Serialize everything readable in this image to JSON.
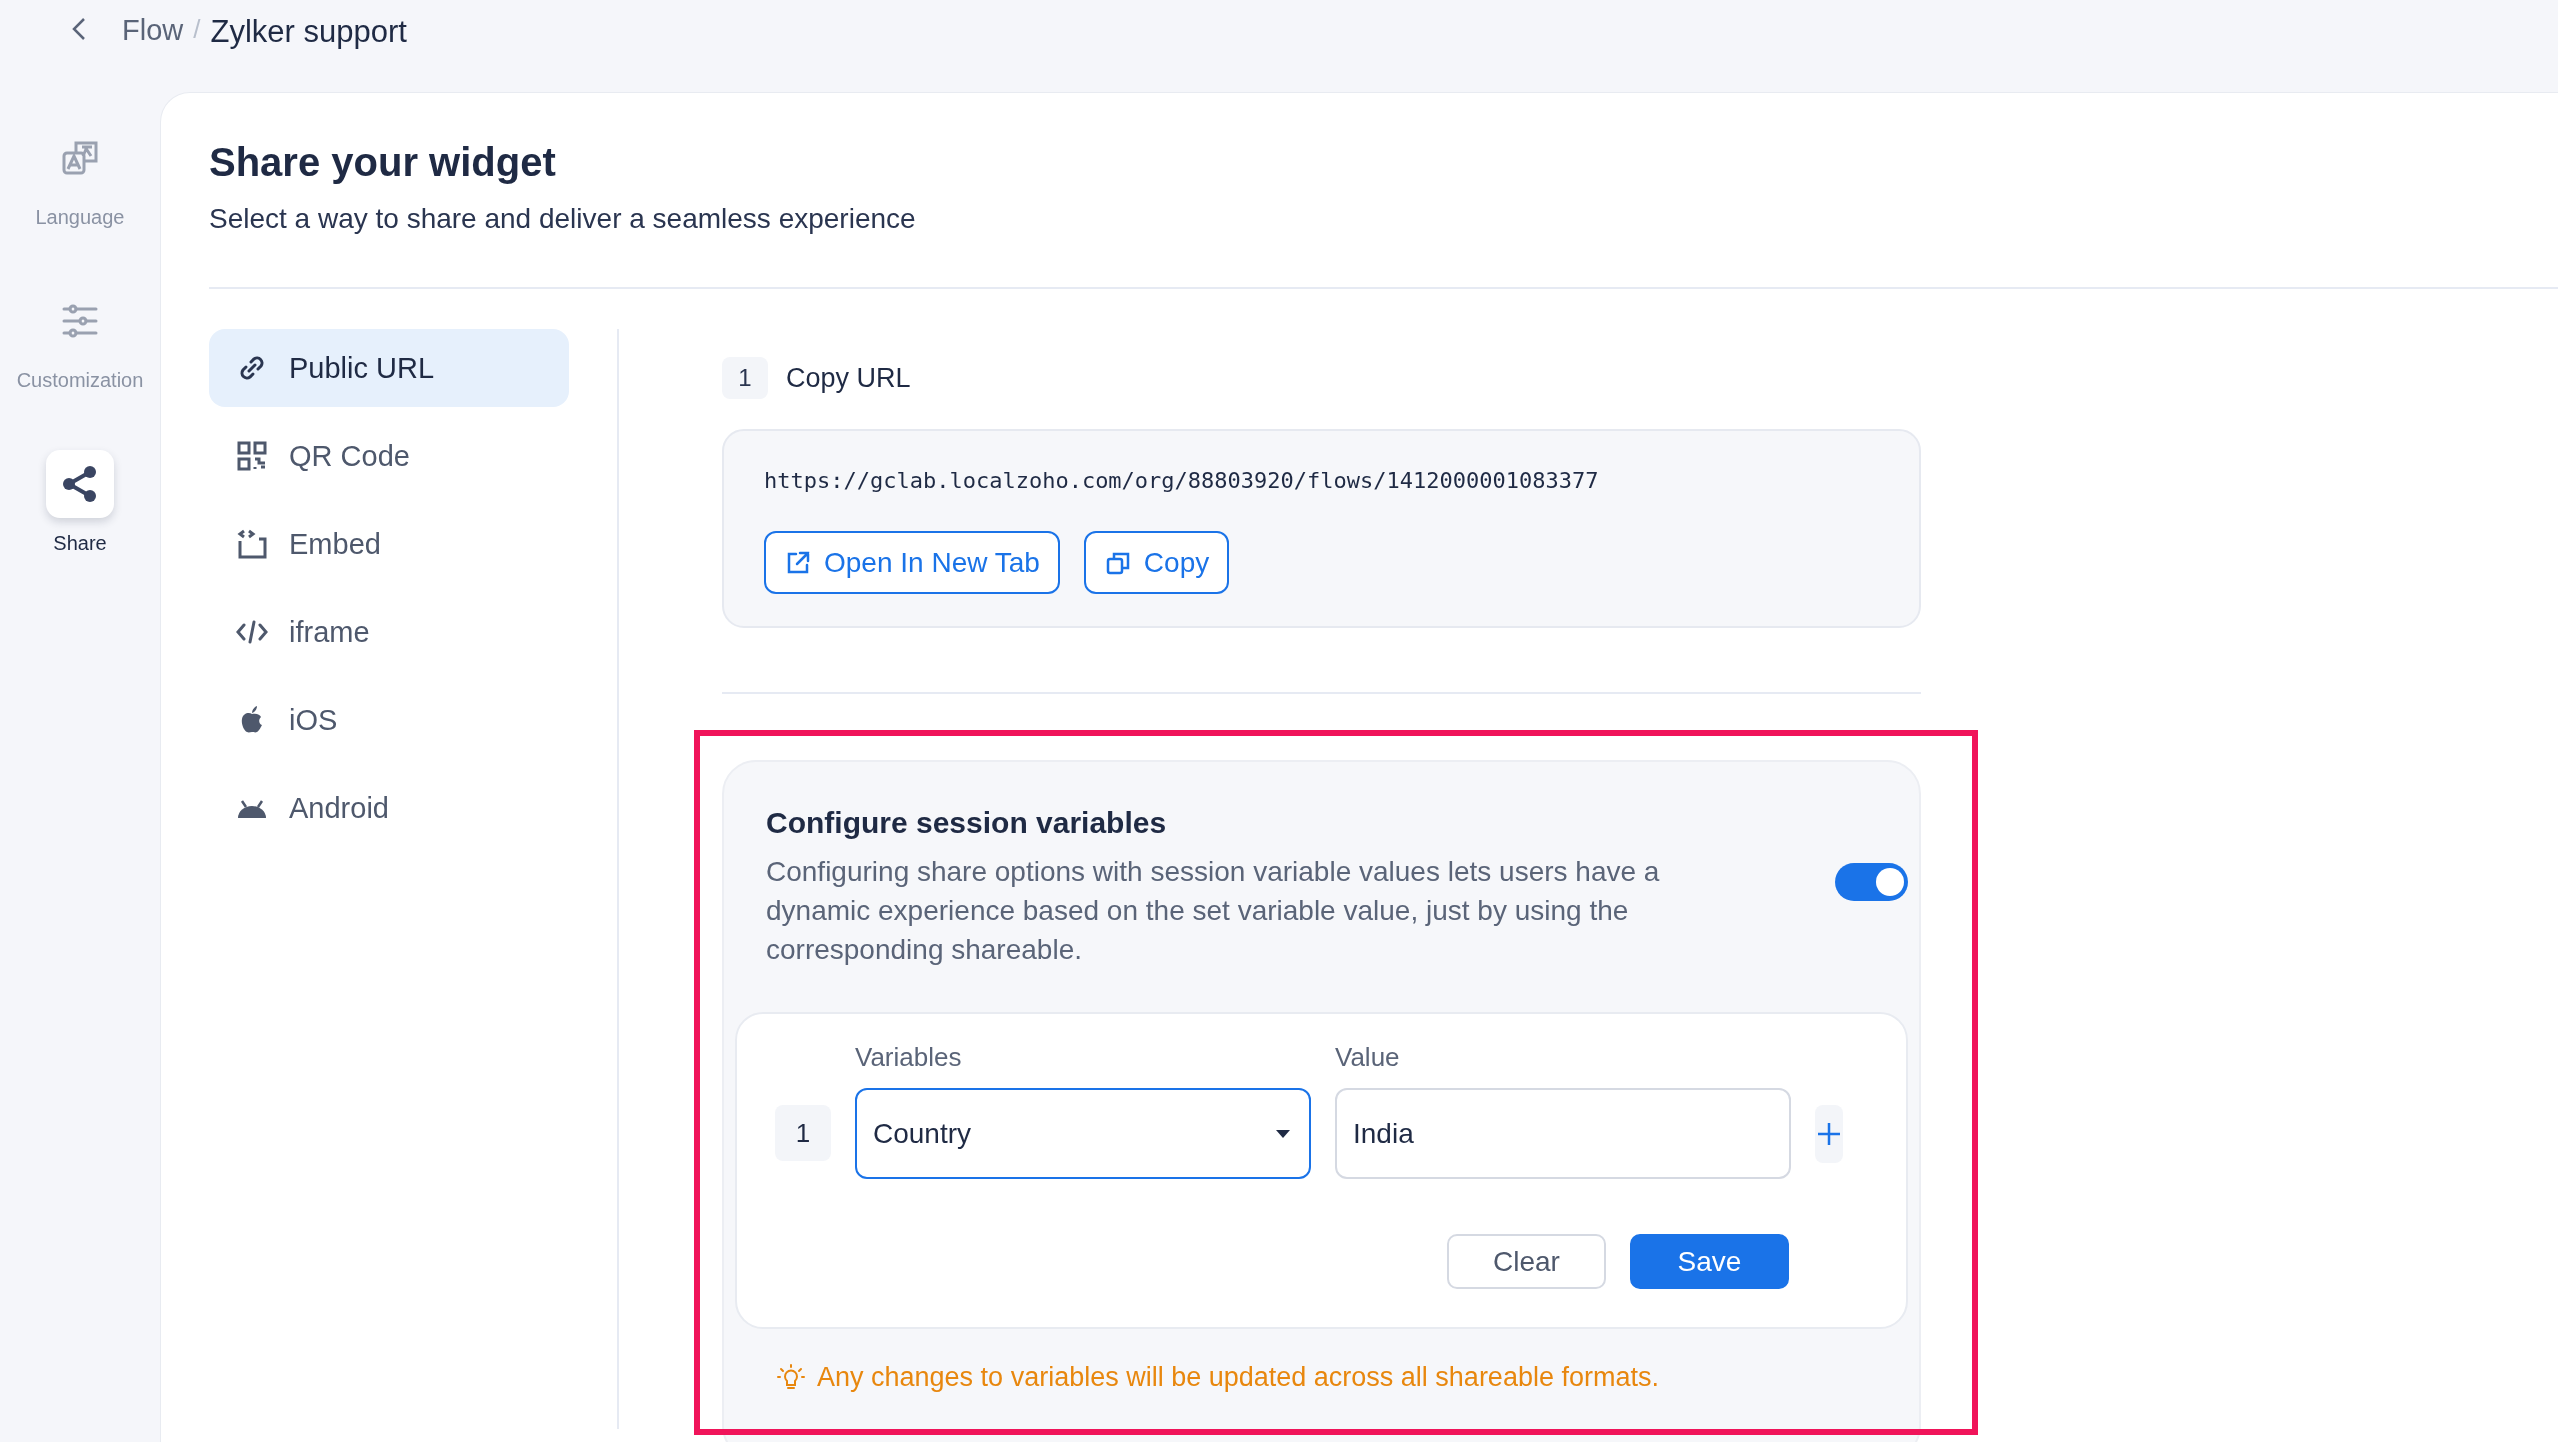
{
  "breadcrumb": {
    "parent": "Flow",
    "separator": "/",
    "current": "Zylker support"
  },
  "rail": [
    {
      "label": "Language",
      "kind": "language",
      "selected": false
    },
    {
      "label": "Customization",
      "kind": "customization",
      "selected": false
    },
    {
      "label": "Share",
      "kind": "share",
      "selected": true
    }
  ],
  "page": {
    "title": "Share your widget",
    "subtitle": "Select a way to share and deliver a seamless experience"
  },
  "share_menu": [
    {
      "label": "Public URL",
      "kind": "url",
      "selected": true
    },
    {
      "label": "QR Code",
      "kind": "qr",
      "selected": false
    },
    {
      "label": "Embed",
      "kind": "embed",
      "selected": false
    },
    {
      "label": "iframe",
      "kind": "iframe",
      "selected": false
    },
    {
      "label": "iOS",
      "kind": "ios",
      "selected": false
    },
    {
      "label": "Android",
      "kind": "android",
      "selected": false
    }
  ],
  "copy_url": {
    "step": "1",
    "heading": "Copy URL",
    "url": "https://gclab.localzoho.com/org/88803920/flows/1412000001083377",
    "buttons": [
      {
        "label": "Open In New Tab",
        "kind": "open"
      },
      {
        "label": "Copy",
        "kind": "copy"
      }
    ]
  },
  "session": {
    "title": "Configure session variables",
    "description": "Configuring share options with session variable values lets users have a dynamic experience based on the set variable value, just by using the corresponding shareable.",
    "enabled": true,
    "row": {
      "number": "1",
      "variable_label": "Variables",
      "variable": "Country",
      "value_label": "Value",
      "value": "India"
    },
    "buttons": [
      {
        "label": "Clear",
        "kind": "secondary"
      },
      {
        "label": "Save",
        "kind": "primary"
      }
    ],
    "note": "Any changes to variables will be updated across all shareable formats."
  },
  "highlight_frame": true
}
